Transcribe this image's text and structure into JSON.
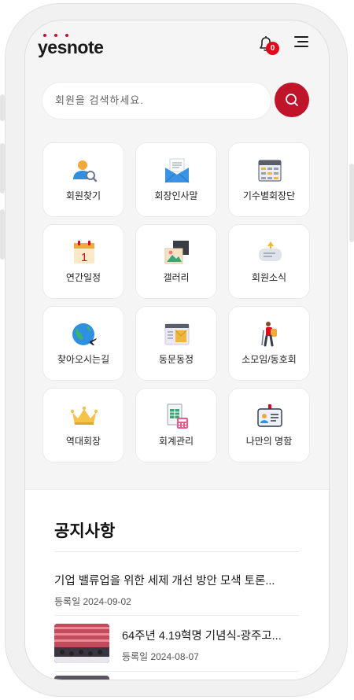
{
  "brand": {
    "logo_text": "yesnote",
    "accent": "#c0142b"
  },
  "header": {
    "notification_count": "0"
  },
  "search": {
    "placeholder": "회원을 검색하세요."
  },
  "menu": {
    "items": [
      {
        "label": "회원찾기",
        "icon": "member-search-icon"
      },
      {
        "label": "회장인사말",
        "icon": "envelope-icon"
      },
      {
        "label": "기수별회장단",
        "icon": "table-icon"
      },
      {
        "label": "연간일정",
        "icon": "calendar-icon"
      },
      {
        "label": "갤러리",
        "icon": "gallery-icon"
      },
      {
        "label": "회원소식",
        "icon": "news-icon"
      },
      {
        "label": "찾아오시는길",
        "icon": "globe-plane-icon"
      },
      {
        "label": "동문동정",
        "icon": "document-icon"
      },
      {
        "label": "소모임/동호회",
        "icon": "hiker-icon"
      },
      {
        "label": "역대회장",
        "icon": "crown-icon"
      },
      {
        "label": "회계관리",
        "icon": "accounting-icon"
      },
      {
        "label": "나만의 명함",
        "icon": "business-card-icon"
      }
    ]
  },
  "notice": {
    "title": "공지사항",
    "items": [
      {
        "title": "기업 밸류업을 위한 세제 개선 방안 모색 토론...",
        "date": "등록일 2024-09-02",
        "has_thumbnail": false
      },
      {
        "title": "64주년 4.19혁명 기념식-광주고...",
        "date": "등록일 2024-08-07",
        "has_thumbnail": true
      }
    ]
  }
}
